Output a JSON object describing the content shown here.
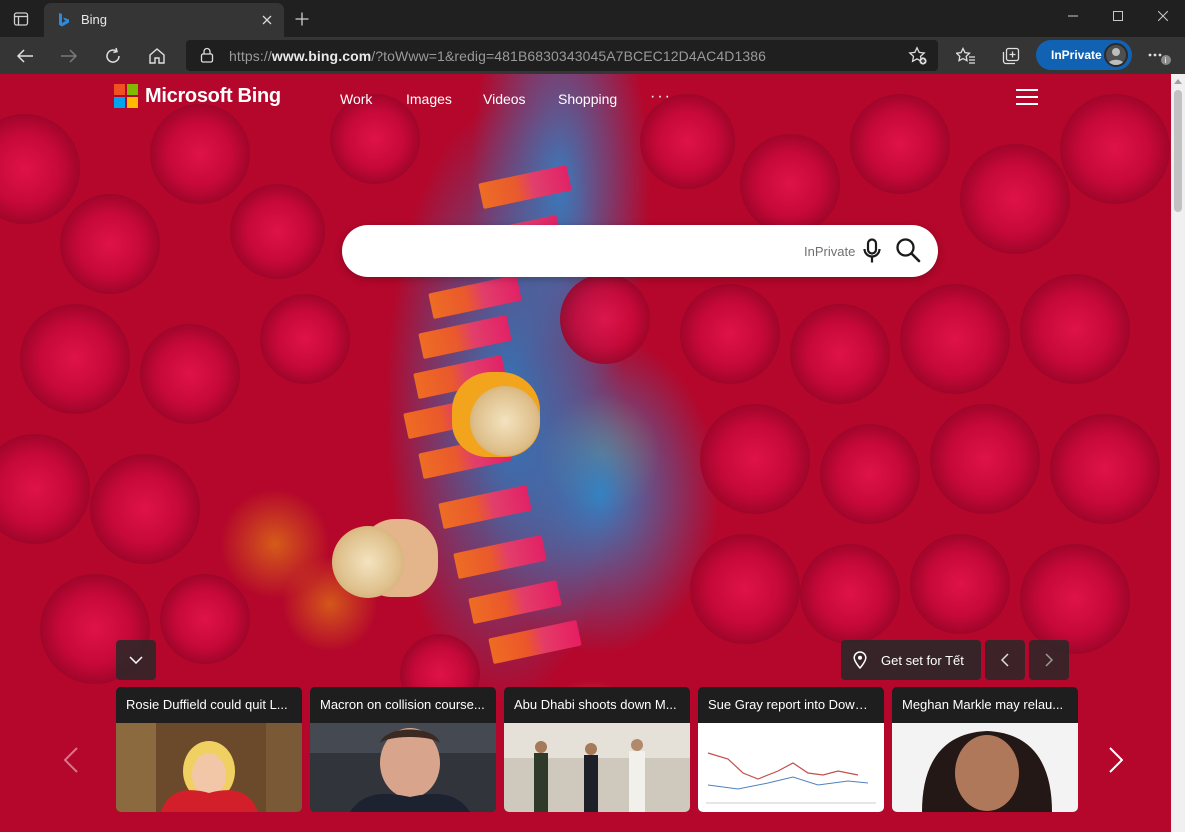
{
  "browser": {
    "tab_title": "Bing",
    "url_prefix": "https://",
    "url_domain": "www.bing.com",
    "url_path": "/?toWww=1&redig=481B6830343045A7BCEC12D4AC4D1386",
    "inprivate_label": "InPrivate"
  },
  "header": {
    "logo_text": "Microsoft Bing",
    "nav": [
      "Work",
      "Images",
      "Videos",
      "Shopping"
    ],
    "more": "···"
  },
  "search": {
    "badge": "InPrivate",
    "placeholder": ""
  },
  "controls": {
    "get_set_label": "Get set for Tết"
  },
  "news": [
    {
      "headline": "Rosie Duffield could quit L..."
    },
    {
      "headline": "Macron on collision course..."
    },
    {
      "headline": "Abu Dhabi shoots down M..."
    },
    {
      "headline": "Sue Gray report into Downi..."
    },
    {
      "headline": "Meghan Markle may relau..."
    }
  ],
  "colors": {
    "accent_blue": "#1262b3",
    "background_red": "#b4072b",
    "ms_red": "#f25022",
    "ms_green": "#7fba00",
    "ms_blue": "#00a4ef",
    "ms_yellow": "#ffb900"
  }
}
